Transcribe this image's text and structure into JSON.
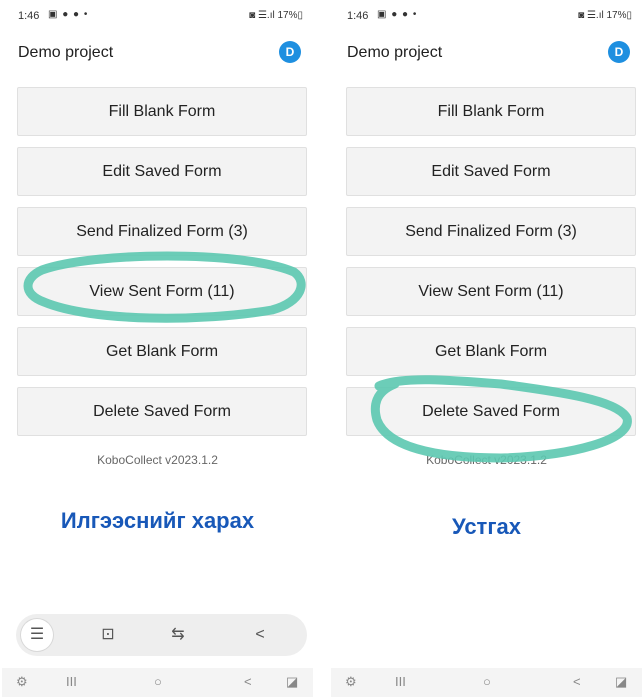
{
  "phones": [
    {
      "status": {
        "time": "1:46",
        "icons": "▣ ● ● •",
        "right": "◙ ☰.ıl 17%▯"
      },
      "app_title": "Demo project",
      "avatar": "D",
      "buttons": [
        "Fill Blank Form",
        "Edit Saved Form",
        "Send Finalized Form (3)",
        "View Sent Form (11)",
        "Get Blank Form",
        "Delete Saved Form"
      ],
      "version": "KoboCollect v2023.1.2",
      "caption": "Илгээснийг харах",
      "highlighted_button": "View Sent Form (11)",
      "toolbar": {
        "menu": "☰",
        "scan": "⊡",
        "translate": "⇆",
        "share": "<"
      },
      "nav": {
        "recent": "⚙",
        "lines": "III",
        "home": "○",
        "back": "<",
        "extra": "◪"
      }
    },
    {
      "status": {
        "time": "1:46",
        "icons": "▣ ● ● •",
        "right": "◙ ☰.ıl 17%▯"
      },
      "app_title": "Demo project",
      "avatar": "D",
      "buttons": [
        "Fill Blank Form",
        "Edit Saved Form",
        "Send Finalized Form (3)",
        "View Sent Form (11)",
        "Get Blank Form",
        "Delete Saved Form"
      ],
      "version": "KoboCollect v2023.1.2",
      "caption": "Устгах",
      "highlighted_button": "Delete Saved Form",
      "nav": {
        "recent": "⚙",
        "lines": "III",
        "home": "○",
        "back": "<",
        "extra": "◪"
      }
    }
  ],
  "colors": {
    "highlight": "#5cc8b0",
    "caption": "#1858b8",
    "avatar": "#1e8fe0",
    "button_bg": "#f3f3f3"
  }
}
